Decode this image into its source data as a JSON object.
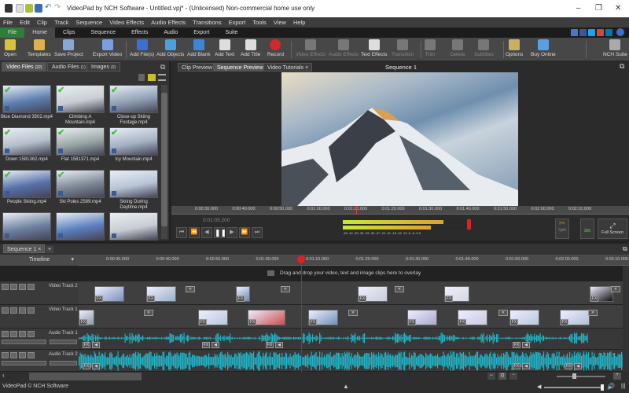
{
  "window": {
    "title": "VideoPad by NCH Software - Untitled.vpj* - (Unlicensed) Non-commercial home use only",
    "minimize": "–",
    "maximize": "❐",
    "close": "✕"
  },
  "menu": [
    "File",
    "Edit",
    "Clip",
    "Track",
    "Sequence",
    "Video Effects",
    "Audio Effects",
    "Transitions",
    "Export",
    "Tools",
    "View",
    "Help"
  ],
  "ribbon_tabs": [
    "File",
    "Home",
    "Clips",
    "Sequence",
    "Effects",
    "Audio",
    "Export",
    "Suite"
  ],
  "ribbon": [
    {
      "label": "Open",
      "icon": "folder-icon",
      "color": "#d8c23a",
      "enabled": true
    },
    {
      "label": "Templates",
      "icon": "templates-icon",
      "color": "#e0b050",
      "enabled": true
    },
    {
      "label": "Save Project",
      "icon": "save-icon",
      "color": "#8aa6d6",
      "enabled": true
    },
    {
      "label": "Export Video",
      "icon": "export-video-icon",
      "color": "#7a9fe0",
      "enabled": true
    },
    {
      "label": "Add File(s)",
      "icon": "add-file-icon",
      "color": "#3b6fd0",
      "enabled": true
    },
    {
      "label": "Add Objects",
      "icon": "add-objects-icon",
      "color": "#4aa0d8",
      "enabled": true
    },
    {
      "label": "Add Blank",
      "icon": "add-blank-icon",
      "color": "#3c86d6",
      "enabled": true
    },
    {
      "label": "Add Text",
      "icon": "add-text-icon",
      "color": "#dddddd",
      "enabled": true
    },
    {
      "label": "Add Title",
      "icon": "add-title-icon",
      "color": "#dddddd",
      "enabled": true
    },
    {
      "label": "Record",
      "icon": "record-icon",
      "color": "#d02a2a",
      "enabled": true
    },
    {
      "label": "Video Effects",
      "icon": "video-effects-icon",
      "color": "#777",
      "enabled": false
    },
    {
      "label": "Audio Effects",
      "icon": "audio-effects-icon",
      "color": "#777",
      "enabled": false
    },
    {
      "label": "Text Effects",
      "icon": "text-effects-icon",
      "color": "#dddddd",
      "enabled": true
    },
    {
      "label": "Transition",
      "icon": "transition-icon",
      "color": "#777",
      "enabled": false
    },
    {
      "label": "Trim",
      "icon": "trim-icon",
      "color": "#777",
      "enabled": false
    },
    {
      "label": "Delete",
      "icon": "delete-icon",
      "color": "#777",
      "enabled": false
    },
    {
      "label": "Subtitles",
      "icon": "subtitles-icon",
      "color": "#777",
      "enabled": false
    },
    {
      "label": "Options",
      "icon": "options-icon",
      "color": "#c8b060",
      "enabled": true
    },
    {
      "label": "Buy Online",
      "icon": "buy-online-icon",
      "color": "#5aa0e0",
      "enabled": true
    },
    {
      "label": "NCH Suite",
      "icon": "nch-suite-icon",
      "color": "#aaa",
      "enabled": true
    }
  ],
  "social_colors": [
    "#4a78c8",
    "#3b5998",
    "#1da1f2",
    "#d34836",
    "#0077b5"
  ],
  "bin": {
    "tabs": [
      {
        "label": "Video Files",
        "count": "(22)"
      },
      {
        "label": "Audio Files",
        "count": "(1)"
      },
      {
        "label": "Images",
        "count": "(0)"
      }
    ],
    "files": [
      {
        "name": "Blue Diamond 3502.mp4",
        "used": true,
        "c": "#5d7fb0"
      },
      {
        "name": "Climbing A Mountain.mp4",
        "used": true,
        "c": "#c9cdd2"
      },
      {
        "name": "Close-up Skiing Footage.mp4",
        "used": true,
        "c": "#8f9fb4"
      },
      {
        "name": "Down 1581362.mp4",
        "used": true,
        "c": "#b5bfcc"
      },
      {
        "name": "Flat 1581371.mp4",
        "used": true,
        "c": "#9aa7a6"
      },
      {
        "name": "Icy Mountain.mp4",
        "used": true,
        "c": "#a4b2c4"
      },
      {
        "name": "People Skiing.mp4",
        "used": true,
        "c": "#5670a8"
      },
      {
        "name": "Ski Poles 2589.mp4",
        "used": true,
        "c": "#7d8896"
      },
      {
        "name": "Skiing During Daytime.mp4",
        "used": false,
        "c": "#b8c4d6"
      },
      {
        "name": "",
        "used": false,
        "c": "#6d80a0"
      },
      {
        "name": "",
        "used": false,
        "c": "#5b7fc0"
      },
      {
        "name": "",
        "used": false,
        "c": "#c8cdd2"
      }
    ]
  },
  "preview": {
    "tabs": [
      "Clip Preview",
      "Sequence Preview",
      "Video Tutorials ×"
    ],
    "title": "Sequence 1",
    "time": "0:01:05.200",
    "ruler": [
      "0:00:30.000",
      "0:00:40.000",
      "0:00:50.000",
      "0:01:00.000",
      "0:01:10.000",
      "0:01:20.000",
      "0:01:30.000",
      "0:01:40.000",
      "0:01:50.000",
      "0:02:00.000",
      "0:02:10.000"
    ],
    "meter_scale": "-45 -42 -39 -36 -33 -30 -27 -24 -21 -18 -15 -12 -9 -6 -3 0",
    "meter_levels": [
      0.8,
      0.7
    ],
    "split": "Split",
    "three60": "360",
    "fullscreen": "Full Screen"
  },
  "timeline": {
    "seq_tab": "Sequence 1 ×",
    "add_tab": "+",
    "mode": "Timeline",
    "ruler": [
      "0:00:30.000",
      "0:00:40.000",
      "0:00:50.000",
      "0:01:00.000",
      "0:01:10.000",
      "0:01:20.000",
      "0:01:30.000",
      "0:01:40.000",
      "0:01:50.000",
      "0:02:00.000",
      "0:02:10.000"
    ],
    "overlay_hint": "Drag and drop your video, text and image clips here to overlay",
    "tracks": [
      "Video Track 2",
      "Video Track 1",
      "Audio Track 1",
      "Audio Track 2"
    ]
  },
  "status": "VideoPad © NCH Software",
  "colors": {
    "accent_green": "#2f7d3a",
    "waveform": "#21b3c6",
    "playhead": "#e02020"
  }
}
